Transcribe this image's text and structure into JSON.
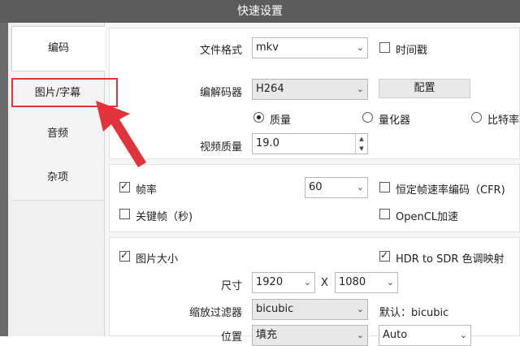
{
  "window": {
    "title": "快速设置"
  },
  "sidebar": {
    "tabs": [
      {
        "label": "编码"
      },
      {
        "label": "图片/字幕"
      },
      {
        "label": "音频"
      },
      {
        "label": "杂项"
      }
    ]
  },
  "format": {
    "label": "文件格式",
    "value": "mkv",
    "timestamp_label": "时间戳"
  },
  "codec": {
    "label": "编解码器",
    "value": "H264",
    "config_button": "配置"
  },
  "quality_mode": {
    "options": [
      "质量",
      "量化器",
      "比特率"
    ],
    "selected": "质量"
  },
  "video_quality": {
    "label": "视频质量",
    "value": "19.0"
  },
  "framerate": {
    "label": "帧率",
    "checked": true,
    "value": "60",
    "cfr_label": "恒定帧速率编码（CFR)",
    "cfr_checked": false
  },
  "keyframe": {
    "label": "关键帧（秒)",
    "checked": false,
    "opencl_label": "OpenCL加速",
    "opencl_checked": false
  },
  "image_size": {
    "label": "图片大小",
    "checked": true,
    "hdr_label": "HDR to SDR 色调映射",
    "hdr_checked": true
  },
  "dimensions": {
    "label": "尺寸",
    "width": "1920",
    "separator": "X",
    "height": "1080"
  },
  "scaler": {
    "label": "缩放过滤器",
    "value": "bicubic",
    "default_text": "默认：bicubic"
  },
  "position": {
    "label": "位置",
    "value": "填充",
    "auto_value": "Auto"
  },
  "colors": {
    "annotation_red": "#e0343a",
    "titlebar": "#5c5c5c"
  }
}
